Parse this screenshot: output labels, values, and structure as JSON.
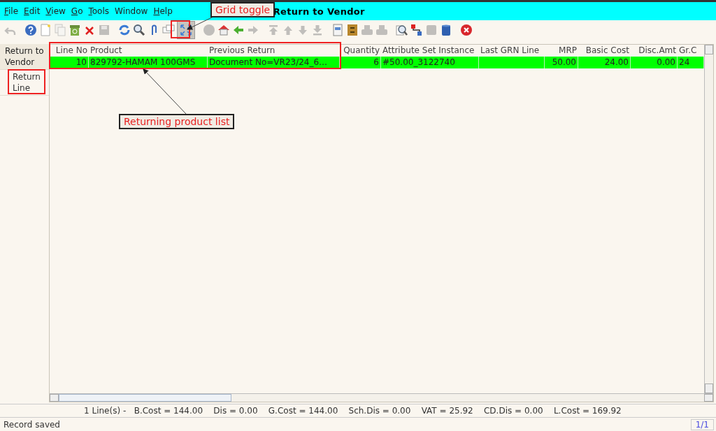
{
  "window": {
    "title": "Return to Vendor"
  },
  "menu": [
    {
      "label": "File",
      "mnemonic_first": true
    },
    {
      "label": "Edit",
      "mnemonic_first": true
    },
    {
      "label": "View",
      "mnemonic_first": true
    },
    {
      "label": "Go",
      "mnemonic_first": true
    },
    {
      "label": "Tools",
      "mnemonic_first": true
    },
    {
      "label": "Window",
      "mnemonic_first": false
    },
    {
      "label": "Help",
      "mnemonic_first": true
    }
  ],
  "toolbar": [
    {
      "kind": "undo",
      "disabled": true,
      "pressed": false
    },
    {
      "kind": "help",
      "disabled": false,
      "pressed": false
    },
    {
      "kind": "new",
      "disabled": false,
      "pressed": false
    },
    {
      "kind": "copy",
      "disabled": true,
      "pressed": false
    },
    {
      "kind": "bin",
      "disabled": false,
      "pressed": false
    },
    {
      "kind": "cross",
      "disabled": false,
      "pressed": false
    },
    {
      "kind": "save",
      "disabled": true,
      "pressed": false
    },
    {
      "kind": "refresh",
      "disabled": false,
      "pressed": false
    },
    {
      "kind": "search",
      "disabled": false,
      "pressed": false
    },
    {
      "kind": "clip",
      "disabled": false,
      "pressed": false
    },
    {
      "kind": "chat",
      "disabled": false,
      "pressed": false
    },
    {
      "kind": "grid",
      "disabled": false,
      "pressed": true
    },
    {
      "kind": "history",
      "disabled": true,
      "pressed": false
    },
    {
      "kind": "home",
      "disabled": false,
      "pressed": false
    },
    {
      "kind": "back",
      "disabled": false,
      "pressed": false
    },
    {
      "kind": "forward",
      "disabled": true,
      "pressed": false
    },
    {
      "kind": "first",
      "disabled": true,
      "pressed": false
    },
    {
      "kind": "up",
      "disabled": true,
      "pressed": false
    },
    {
      "kind": "down",
      "disabled": true,
      "pressed": false
    },
    {
      "kind": "last",
      "disabled": true,
      "pressed": false
    },
    {
      "kind": "report",
      "disabled": false,
      "pressed": false
    },
    {
      "kind": "archive",
      "disabled": false,
      "pressed": false
    },
    {
      "kind": "print",
      "disabled": true,
      "pressed": false
    },
    {
      "kind": "print",
      "disabled": true,
      "pressed": false
    },
    {
      "kind": "zoom",
      "disabled": false,
      "pressed": false
    },
    {
      "kind": "workflow",
      "disabled": false,
      "pressed": false
    },
    {
      "kind": "request",
      "disabled": true,
      "pressed": false
    },
    {
      "kind": "product",
      "disabled": false,
      "pressed": false
    },
    {
      "kind": "close",
      "disabled": false,
      "pressed": false
    }
  ],
  "sidebar": {
    "items": [
      {
        "label": "Return to Vendor",
        "selected": true
      },
      {
        "label": "Return Line",
        "selected": false
      }
    ]
  },
  "table": {
    "columns": [
      {
        "label": "Line No"
      },
      {
        "label": "Product"
      },
      {
        "label": "Previous Return"
      },
      {
        "label": "Quantity"
      },
      {
        "label": "Attribute Set Instance"
      },
      {
        "label": "Last GRN Line"
      },
      {
        "label": "MRP"
      },
      {
        "label": "Basic Cost"
      },
      {
        "label": "Disc.Amt"
      },
      {
        "label": "Gr.C"
      }
    ],
    "rows": [
      {
        "selected": true,
        "cells": [
          "10",
          "829792-HAMAM 100GMS",
          "Document No=VR23/24_6…",
          "6",
          "#50.00_3122740",
          "",
          "50.00",
          "24.00",
          "0.00",
          "24"
        ]
      }
    ]
  },
  "summary": "1 Line(s) -   B.Cost = 144.00    Dis = 0.00    G.Cost = 144.00    Sch.Dis = 0.00    VAT = 25.92    CD.Dis = 0.00    L.Cost = 169.92",
  "status_bar": {
    "message": "Record saved",
    "record": "1/1"
  },
  "annotations": [
    {
      "text": "Grid toggle"
    },
    {
      "text": "Returning product list"
    }
  ]
}
